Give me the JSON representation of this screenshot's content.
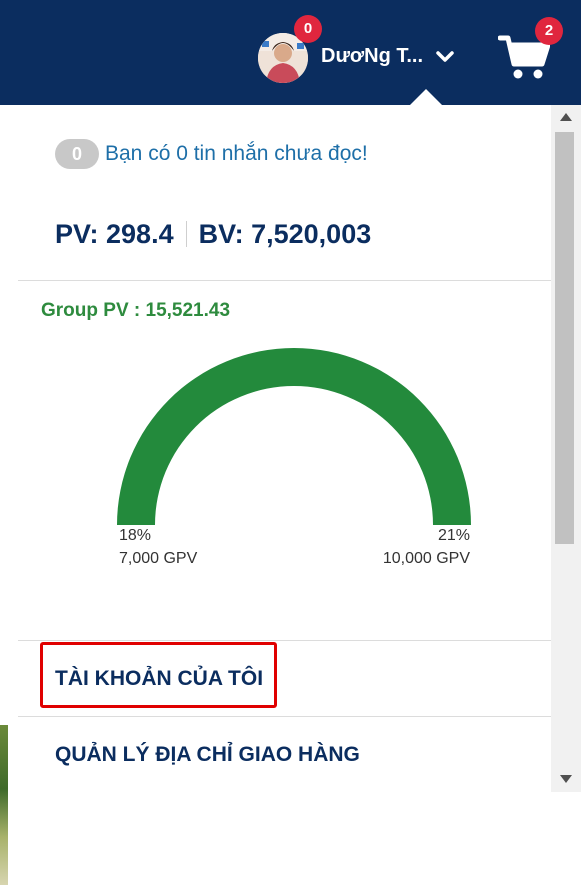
{
  "header": {
    "user_name": "DươNg T...",
    "notification_count": "0",
    "cart_count": "2",
    "bg_color": "#0b2d5f"
  },
  "dropdown": {
    "messages": {
      "count": "0",
      "text": "Bạn có 0 tin nhắn chưa đọc!"
    },
    "pv": "PV: 298.4",
    "bv": "BV: 7,520,003",
    "group_pv": "Group PV : 15,521.43",
    "gauge": {
      "left_percent": "18%",
      "left_gpv": "7,000 GPV",
      "right_percent": "21%",
      "right_gpv": "10,000 GPV",
      "fill_color": "#238a3c"
    },
    "menu": [
      {
        "label": "TÀI KHOẢN CỦA TÔI",
        "highlighted": true
      },
      {
        "label": "QUẢN LÝ ĐỊA CHỈ GIAO HÀNG"
      }
    ]
  },
  "colors": {
    "navy": "#0b2d5f",
    "badge_red": "#e0263e",
    "green": "#2e8b3e",
    "link_blue": "#1e6fa8",
    "highlight_red": "#e00000"
  }
}
